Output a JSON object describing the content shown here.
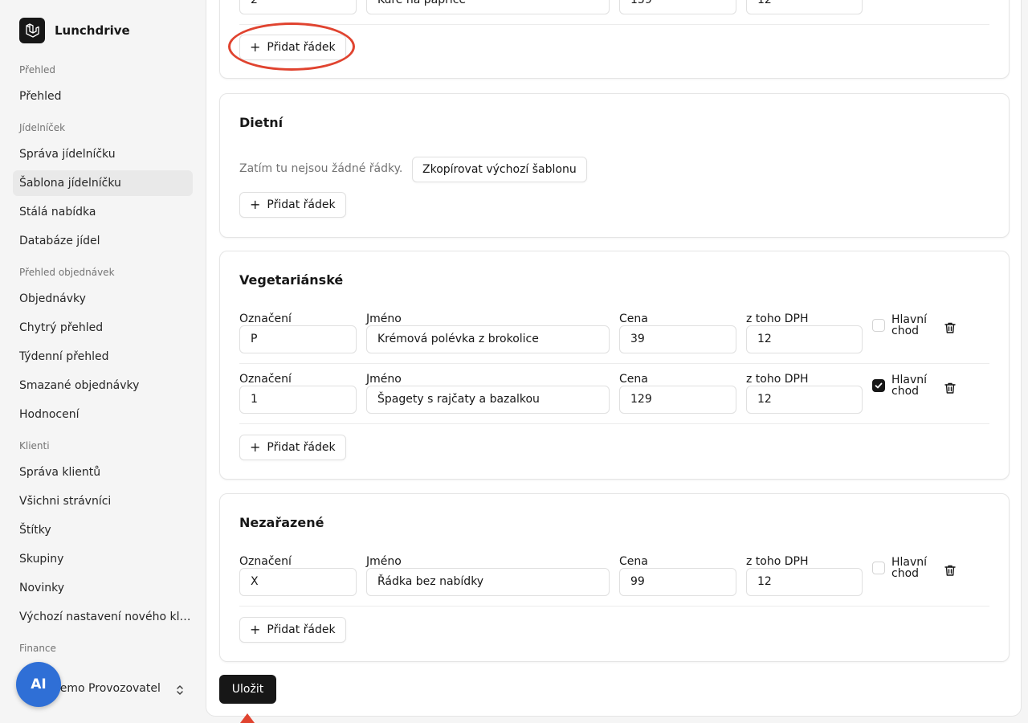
{
  "app": {
    "name": "Lunchdrive"
  },
  "sidebar": {
    "groups": [
      {
        "heading": "Přehled",
        "items": [
          "Přehled"
        ]
      },
      {
        "heading": "Jídelníček",
        "items": [
          "Správa jídelníčku",
          "Šablona jídelníčku",
          "Stálá nabídka",
          "Databáze jídel"
        ]
      },
      {
        "heading": "Přehled objednávek",
        "items": [
          "Objednávky",
          "Chytrý přehled",
          "Týdenní přehled",
          "Smazané objednávky",
          "Hodnocení"
        ]
      },
      {
        "heading": "Klienti",
        "items": [
          "Správa klientů",
          "Všichni strávníci",
          "Štítky",
          "Skupiny",
          "Novinky",
          "Výchozí nastavení nového klienta"
        ]
      },
      {
        "heading": "Finance",
        "items": []
      }
    ],
    "active_item": "Šablona jídelníčku",
    "user": {
      "initials": "AI",
      "name": "Demo Provozovatel"
    }
  },
  "labels": {
    "code": "Označení",
    "name": "Jméno",
    "price": "Cena",
    "vat": "z toho DPH",
    "main_course_line1": "Hlavní",
    "main_course_line2": "chod",
    "add_row": "Přidat řádek",
    "empty": "Zatím tu nejsou žádné řádky.",
    "copy_template": "Zkopírovat výchozí šablonu",
    "save": "Uložit"
  },
  "top_partial_row": {
    "code": "2",
    "name": "Kuře na paprice",
    "price": "159",
    "vat": "12"
  },
  "sections": [
    {
      "title": "Dietní",
      "rows": []
    },
    {
      "title": "Vegetariánské",
      "rows": [
        {
          "code": "P",
          "name": "Krémová polévka z brokolice",
          "price": "39",
          "vat": "12",
          "main": false
        },
        {
          "code": "1",
          "name": "Špagety s rajčaty a bazalkou",
          "price": "129",
          "vat": "12",
          "main": true
        }
      ]
    },
    {
      "title": "Nezařazené",
      "rows": [
        {
          "code": "X",
          "name": "Řádka bez nabídky",
          "price": "99",
          "vat": "12",
          "main": false
        }
      ]
    }
  ],
  "colors": {
    "accent": "#171717",
    "annotation": "#e0432f",
    "avatar": "#2f6fd6"
  }
}
